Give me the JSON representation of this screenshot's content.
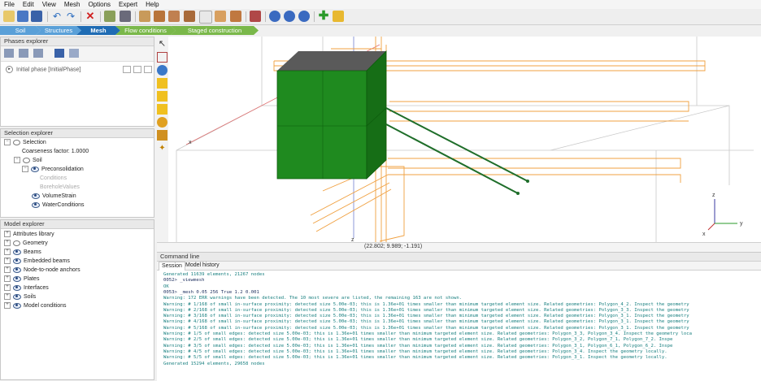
{
  "menu": [
    "File",
    "Edit",
    "View",
    "Mesh",
    "Options",
    "Expert",
    "Help"
  ],
  "modes": [
    {
      "label": "Soil",
      "color": "#5aa0d8"
    },
    {
      "label": "Structures",
      "color": "#5aa0d8"
    },
    {
      "label": "Mesh",
      "color": "#1f6cb4"
    },
    {
      "label": "Flow conditions",
      "color": "#7ab84a"
    },
    {
      "label": "Staged construction",
      "color": "#7ab84a"
    }
  ],
  "phases": {
    "title": "Phases explorer",
    "items": [
      "Initial phase [InitialPhase]"
    ]
  },
  "selection": {
    "title": "Selection explorer",
    "root": "Selection",
    "coarseness": "Coarseness factor: 1.0000",
    "soil": "Soil",
    "preconsolidation": "Preconsolidation",
    "conditions": "Conditions",
    "borehole_values": "BoreholeValues",
    "volume_strain": "VolumeStrain",
    "water_conditions": "WaterConditions"
  },
  "model": {
    "title": "Model explorer",
    "items": [
      "Attributes library",
      "Geometry",
      "Beams",
      "Embedded beams",
      "Node-to-node anchors",
      "Plates",
      "Interfaces",
      "Soils",
      "Model conditions"
    ]
  },
  "viewport": {
    "axis_x": "x",
    "axis_z": "z",
    "triad_z": "z",
    "triad_y": "y",
    "triad_x": "x",
    "coords": "(22.802; 9.989; -1.191)"
  },
  "command": {
    "title": "Command line",
    "tabs": [
      "Session",
      "Model history"
    ],
    "lines": [
      {
        "t": "Generated 11639 elements, 21267 nodes",
        "c": "c-teal"
      },
      {
        "t": "0052> _viewmesh",
        "c": "c-dark"
      },
      {
        "t": "OK",
        "c": "c-teal"
      },
      {
        "t": "0053> _mesh 0.05 256 True 1.2 0.001",
        "c": "c-dark"
      },
      {
        "t": "Warning: 172 ERR warnings have been detected. The 10 most severe are listed, the remaining 163 are not shown.",
        "c": "c-teal"
      },
      {
        "t": "Warning: # 1/168 of small in-surface proximity: detected size 5.00e-03; this is 1.36e+01 times smaller than minimum targeted element size. Related geometries: Polygon_4_2. Inspect the geometry",
        "c": "c-teal"
      },
      {
        "t": "Warning: # 2/168 of small in-surface proximity: detected size 5.00e-03; this is 1.36e+01 times smaller than minimum targeted element size. Related geometries: Polygon_3_3. Inspect the geometry",
        "c": "c-teal"
      },
      {
        "t": "Warning: # 3/168 of small in-surface proximity: detected size 5.00e-03; this is 1.36e+01 times smaller than minimum targeted element size. Related geometries: Polygon_3_1. Inspect the geometry",
        "c": "c-teal"
      },
      {
        "t": "Warning: # 4/168 of small in-surface proximity: detected size 5.00e-03; this is 1.36e+01 times smaller than minimum targeted element size. Related geometries: Polygon_3_1. Inspect the geometry",
        "c": "c-teal"
      },
      {
        "t": "Warning: # 5/168 of small in-surface proximity: detected size 5.00e-03; this is 1.36e+01 times smaller than minimum targeted element size. Related geometries: Polygon_3_1. Inspect the geometry",
        "c": "c-teal"
      },
      {
        "t": "Warning: # 1/5 of small edges: detected size 5.00e-03; this is 1.36e+01 times smaller than minimum targeted element size. Related geometries: Polygon_3_3, Polygon_3_4. Inspect the geometry loca",
        "c": "c-teal"
      },
      {
        "t": "Warning: # 2/5 of small edges: detected size 5.00e-03; this is 1.36e+01 times smaller than minimum targeted element size. Related geometries: Polygon_3_2, Polygon_7_1, Polygon_7_2. Inspe",
        "c": "c-teal"
      },
      {
        "t": "Warning: # 3/5 of small edges: detected size 5.00e-03; this is 1.36e+01 times smaller than minimum targeted element size. Related geometries: Polygon_3_1, Polygon_6_1, Polygon_6_2. Inspe",
        "c": "c-teal"
      },
      {
        "t": "Warning: # 4/5 of small edges: detected size 5.00e-03; this is 1.36e+01 times smaller than minimum targeted element size. Related geometries: Polygon_3_4. Inspect the geometry locally.",
        "c": "c-teal"
      },
      {
        "t": "Warning: # 5/5 of small edges: detected size 5.00e-03; this is 1.36e+01 times smaller than minimum targeted element size. Related geometries: Polygon_3_1. Inspect the geometry locally.",
        "c": "c-teal"
      },
      {
        "t": "Generated 15294 elements, 29658 nodes",
        "c": "c-teal"
      }
    ]
  }
}
